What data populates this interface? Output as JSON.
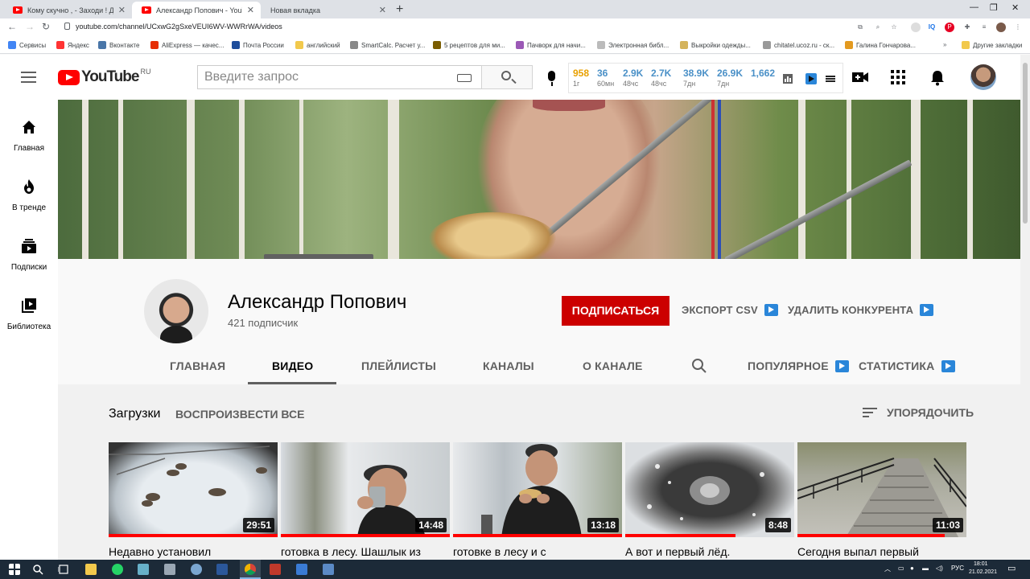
{
  "browser": {
    "tabs": [
      {
        "title": "Кому скучно , - Заходи ! Донат ...",
        "active": false
      },
      {
        "title": "Александр Попович - YouTube",
        "active": true
      },
      {
        "title": "Новая вкладка",
        "active": false
      }
    ],
    "new_tab_label": "+",
    "url": "youtube.com/channel/UCxwG2gSxeVEUI6WV-WWRrWA/videos",
    "bookmarks": [
      {
        "label": "Сервисы"
      },
      {
        "label": "Яндекс"
      },
      {
        "label": "Вконтакте"
      },
      {
        "label": "AliExpress — качес..."
      },
      {
        "label": "Почта России"
      },
      {
        "label": "английский"
      },
      {
        "label": "SmartCalc. Расчет у..."
      },
      {
        "label": "5 рецептов для ми..."
      },
      {
        "label": "Пачворк для начи..."
      },
      {
        "label": "Электронная библ..."
      },
      {
        "label": "Выкройки одежды..."
      },
      {
        "label": "chitatel.ucoz.ru - ск..."
      },
      {
        "label": "Галина Гончарова..."
      },
      {
        "label": "Другие закладки"
      }
    ]
  },
  "youtube": {
    "logo_text": "YouTube",
    "country_code": "RU",
    "search_placeholder": "Введите запрос",
    "stats": [
      {
        "value": "958",
        "label": "1г"
      },
      {
        "value": "36",
        "label": "60мн"
      },
      {
        "value": "2.9K",
        "label": "48чс"
      },
      {
        "value": "2.7K",
        "label": "48чс"
      },
      {
        "value": "38.9K",
        "label": "7дн"
      },
      {
        "value": "26.9K",
        "label": "7дн"
      },
      {
        "value": "1,662",
        "label": ""
      }
    ],
    "guide": [
      {
        "label": "Главная",
        "icon": "home-icon"
      },
      {
        "label": "В тренде",
        "icon": "fire-icon"
      },
      {
        "label": "Подписки",
        "icon": "subscriptions-icon"
      },
      {
        "label": "Библиотека",
        "icon": "library-icon"
      }
    ],
    "tooltip": "Александр Попович",
    "channel": {
      "name": "Александр Попович",
      "subscribers": "421 подписчик",
      "subscribe_label": "ПОДПИСАТЬСЯ",
      "export_label": "ЭКСПОРТ CSV",
      "remove_competitor_label": "УДАЛИТЬ КОНКУРЕНТА"
    },
    "tabs": [
      {
        "label": "ГЛАВНАЯ"
      },
      {
        "label": "ВИДЕО"
      },
      {
        "label": "ПЛЕЙЛИСТЫ"
      },
      {
        "label": "КАНАЛЫ"
      },
      {
        "label": "О КАНАЛЕ"
      },
      {
        "label": "ПОПУЛЯРНОЕ"
      },
      {
        "label": "СТАТИСТИКА"
      }
    ],
    "active_tab": "ВИДЕО",
    "section_title": "Загрузки",
    "play_all_label": "ВОСПРОИЗВЕСТИ ВСЕ",
    "sort_label": "УПОРЯДОЧИТЬ",
    "videos": [
      {
        "title": "Недавно установил",
        "duration": "29:51",
        "watched": 1.0
      },
      {
        "title": "готовка в лесу. Шашлык из",
        "duration": "14:48",
        "watched": 1.0
      },
      {
        "title": "готовке в лесу и с",
        "duration": "13:18",
        "watched": 1.0
      },
      {
        "title": "А вот и первый лёд.",
        "duration": "8:48",
        "watched": 0.65
      },
      {
        "title": "Сегодня выпал первый",
        "duration": "11:03",
        "watched": 0.87
      }
    ]
  },
  "taskbar": {
    "language": "РУС",
    "time": "18:01",
    "date": "21.02.2021"
  },
  "colors": {
    "youtube_red": "#ff0000",
    "subscribe_red": "#cc0000",
    "stat_blue": "#4a90c7",
    "stat_gold": "#e8a000"
  }
}
